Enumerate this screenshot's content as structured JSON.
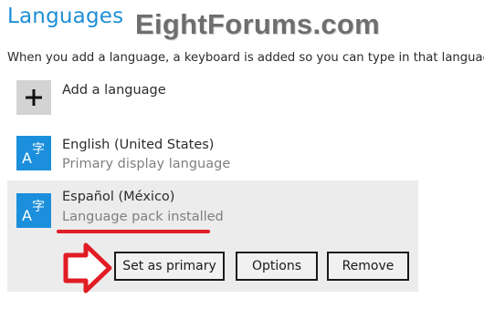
{
  "header": {
    "title": "Languages",
    "watermark": "EightForums.com"
  },
  "description": "When you add a language, a keyboard is added so you can type in that language.",
  "add_language": {
    "label": "Add a language",
    "icon": "plus-icon"
  },
  "languages": [
    {
      "name": "English (United States)",
      "status": "Primary display language",
      "icon": "language-a-zi-icon",
      "selected": false
    },
    {
      "name": "Español (México)",
      "status": "Language pack installed",
      "icon": "language-a-zi-icon",
      "selected": true
    }
  ],
  "actions": {
    "set_primary": "Set as primary",
    "options": "Options",
    "remove": "Remove"
  },
  "colors": {
    "accent": "#1e8fd6",
    "tile_blue": "#1b8fdc",
    "annotation_red": "#e01c24",
    "selected_bg": "#ececec"
  }
}
